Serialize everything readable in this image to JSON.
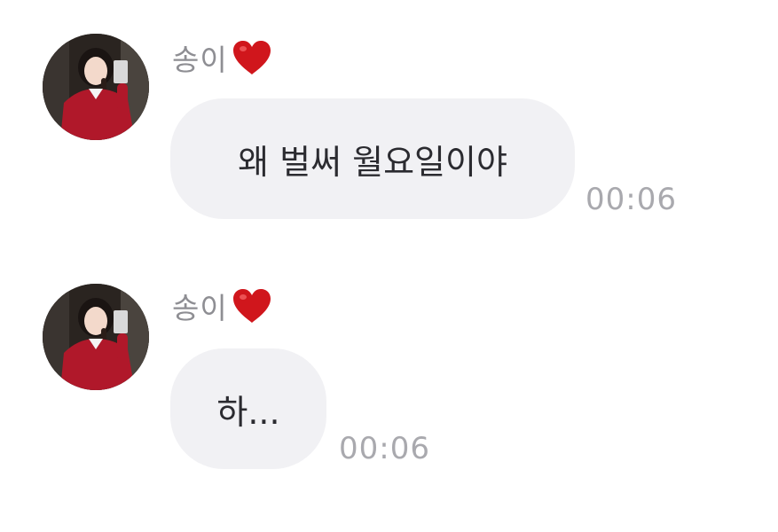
{
  "messages": [
    {
      "sender": "송이",
      "text": "왜 벌써 월요일이야",
      "time": "00:06",
      "sender_icon": "heart-icon",
      "avatar": "avatar-photo"
    },
    {
      "sender": "송이",
      "text": "하...",
      "time": "00:06",
      "sender_icon": "heart-icon",
      "avatar": "avatar-photo"
    }
  ],
  "colors": {
    "bubble": "#f1f1f4",
    "text": "#2b2b30",
    "sender": "#8e8e93",
    "timestamp": "#a9a9ae",
    "heart": "#d0161c"
  }
}
